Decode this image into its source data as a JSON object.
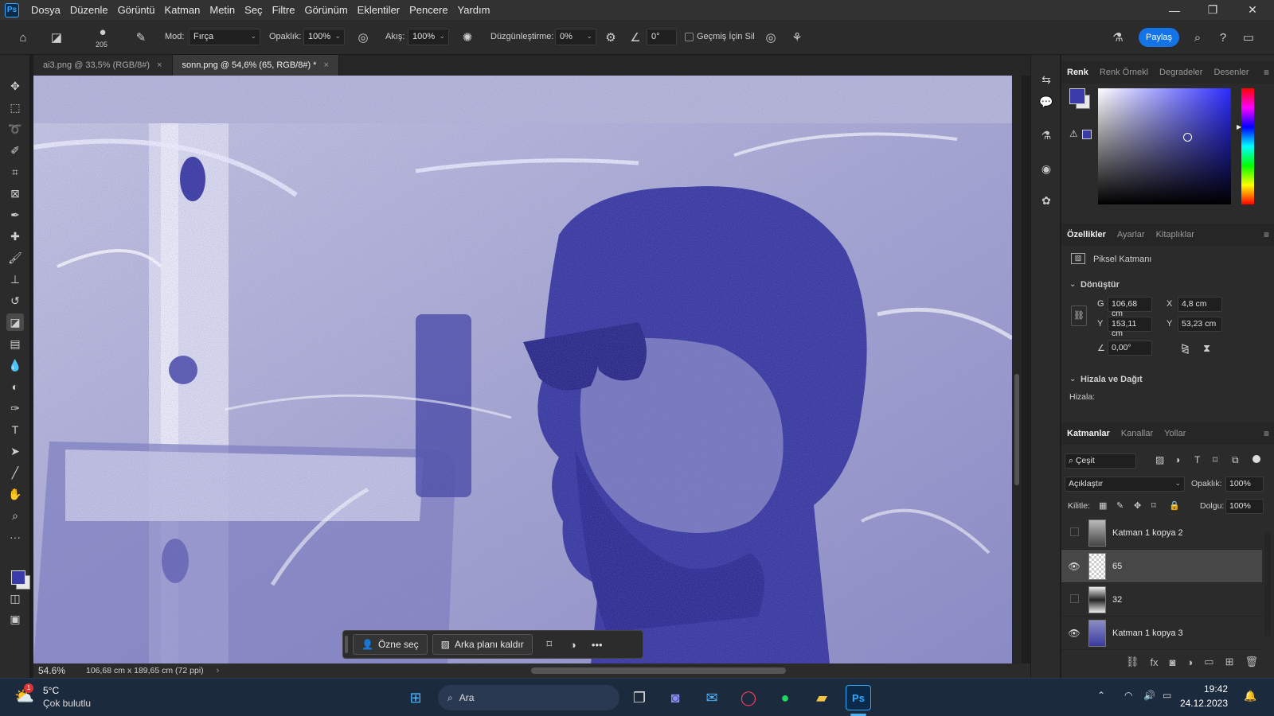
{
  "app": {
    "logo": "Ps",
    "menu": [
      "Dosya",
      "Düzenle",
      "Görüntü",
      "Katman",
      "Metin",
      "Seç",
      "Filtre",
      "Görünüm",
      "Eklentiler",
      "Pencere",
      "Yardım"
    ]
  },
  "window_controls": {
    "minimize": "—",
    "restore": "❐",
    "close": "✕"
  },
  "options": {
    "brush_size": "205",
    "mode_label": "Mod:",
    "mode_value": "Fırça",
    "opacity_label": "Opaklık:",
    "opacity_value": "100%",
    "flow_label": "Akış:",
    "flow_value": "100%",
    "smoothing_label": "Düzgünleştirme:",
    "smoothing_value": "0%",
    "angle_value": "0°",
    "history_label": "Geçmiş İçin Sil",
    "share_label": "Paylaş"
  },
  "tabs": [
    {
      "label": "ai3.png @ 33,5% (RGB/8#)",
      "close": "×"
    },
    {
      "label": "sonn.png @ 54,6% (65, RGB/8#) *",
      "close": "×"
    }
  ],
  "context_bar": {
    "subject_label": "Özne seç",
    "remove_bg_label": "Arka planı kaldır",
    "more": "•••"
  },
  "status": {
    "zoom": "54.6%",
    "doc_info": "106,68 cm x 189,65 cm (72 ppi)",
    "arrow": "›"
  },
  "color_panel": {
    "tabs": [
      "Renk",
      "Renk Örnekl",
      "Degradeler",
      "Desenler"
    ],
    "foreground": "#3a3aa8",
    "background": "#e8e8e8"
  },
  "properties_panel": {
    "tabs": [
      "Özellikler",
      "Ayarlar",
      "Kitaplıklar"
    ],
    "layer_type": "Piksel Katmanı",
    "transform_title": "Dönüştür",
    "w_label": "G",
    "w_value": "106,68 cm",
    "x_label": "X",
    "x_value": "4,8 cm",
    "h_label": "Y",
    "h_value": "153,11 cm",
    "y_label": "Y",
    "y_value": "53,23 cm",
    "angle_value": "0,00°",
    "align_title": "Hizala ve Dağıt",
    "align_label": "Hizala:"
  },
  "layers_panel": {
    "tabs": [
      "Katmanlar",
      "Kanallar",
      "Yollar"
    ],
    "filter_label": "Çeşit",
    "blend_mode": "Açıklaştır",
    "opacity_label": "Opaklık:",
    "opacity_value": "100%",
    "lock_label": "Kilitle:",
    "fill_label": "Dolgu:",
    "fill_value": "100%",
    "layers": [
      {
        "name": "Katman 1 kopya 2",
        "visible": false,
        "selected": false
      },
      {
        "name": "65",
        "visible": true,
        "selected": true
      },
      {
        "name": "32",
        "visible": false,
        "selected": false
      },
      {
        "name": "Katman 1 kopya 3",
        "visible": true,
        "selected": false
      }
    ]
  },
  "taskbar": {
    "weather_temp": "5°C",
    "weather_desc": "Çok bulutlu",
    "weather_badge": "1",
    "search_label": "Ara",
    "time": "19:42",
    "date": "24.12.2023"
  }
}
